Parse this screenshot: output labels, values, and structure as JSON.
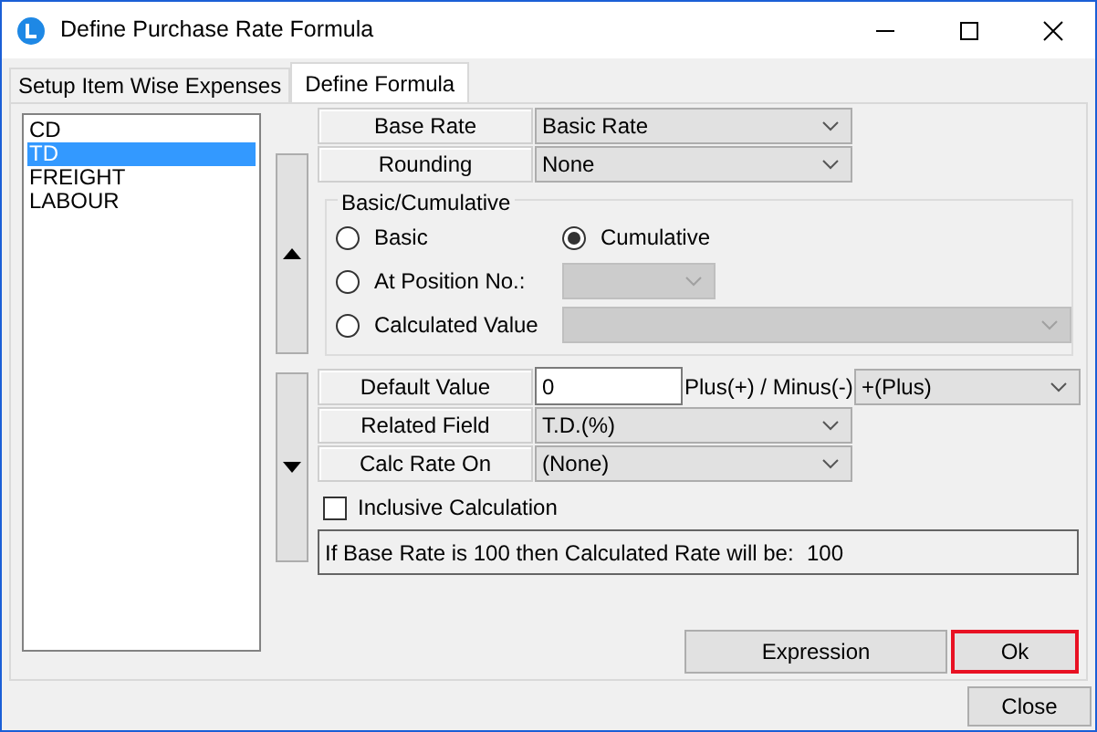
{
  "window": {
    "title": "Define Purchase Rate Formula"
  },
  "tabs": [
    {
      "label": "Setup Item Wise Expenses",
      "selected": false
    },
    {
      "label": "Define Formula",
      "selected": true
    }
  ],
  "items": [
    {
      "label": "CD",
      "selected": false
    },
    {
      "label": "TD",
      "selected": true
    },
    {
      "label": "FREIGHT",
      "selected": false
    },
    {
      "label": "LABOUR",
      "selected": false
    }
  ],
  "base_rate": {
    "label": "Base Rate",
    "value": "Basic Rate"
  },
  "rounding": {
    "label": "Rounding",
    "value": "None"
  },
  "group": {
    "title": "Basic/Cumulative",
    "options": [
      {
        "label": "Basic",
        "selected": false
      },
      {
        "label": "Cumulative",
        "selected": true
      },
      {
        "label": "At Position No.:",
        "selected": false
      },
      {
        "label": "Calculated Value",
        "selected": false
      }
    ]
  },
  "default_value": {
    "label": "Default Value",
    "value": "0",
    "sign_label": "Plus(+) / Minus(-)",
    "sign_value": "+(Plus)"
  },
  "related_field": {
    "label": "Related Field",
    "value": "T.D.(%)"
  },
  "calc_rate_on": {
    "label": "Calc Rate On",
    "value": "(None)"
  },
  "inclusive": {
    "label": "Inclusive Calculation",
    "checked": false
  },
  "info": {
    "text": "If Base Rate is 100 then Calculated Rate will be:",
    "value": "100"
  },
  "buttons": [
    {
      "label": "Expression",
      "focused": false
    },
    {
      "label": "Ok",
      "focused": true
    }
  ],
  "close": {
    "label": "Close"
  }
}
